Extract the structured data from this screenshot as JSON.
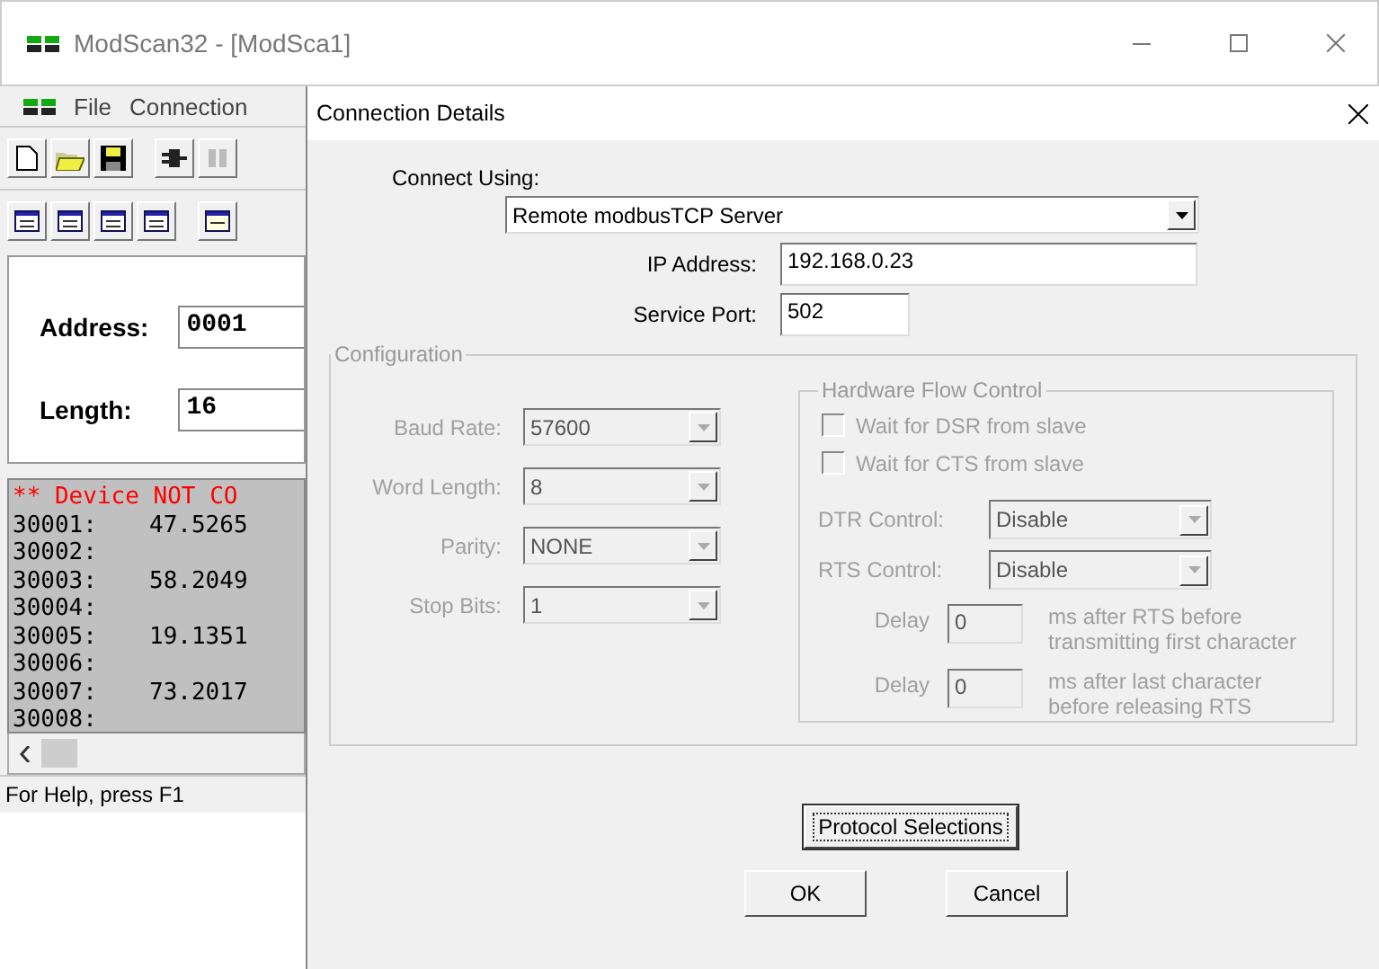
{
  "main_window": {
    "title": "ModScan32 - [ModSca1]",
    "menu": [
      "File",
      "Connection"
    ],
    "address_label": "Address:",
    "address_value": "0001",
    "length_label": "Length:",
    "length_value": "16",
    "status_message": "** Device NOT CO",
    "data_rows": [
      {
        "address": "30001:",
        "value": "47.5265"
      },
      {
        "address": "30002:",
        "value": ""
      },
      {
        "address": "30003:",
        "value": "58.2049"
      },
      {
        "address": "30004:",
        "value": ""
      },
      {
        "address": "30005:",
        "value": "19.1351"
      },
      {
        "address": "30006:",
        "value": ""
      },
      {
        "address": "30007:",
        "value": "73.2017"
      },
      {
        "address": "30008:",
        "value": ""
      }
    ],
    "status_bar": "For Help, press F1"
  },
  "dialog": {
    "title": "Connection Details",
    "connect_using_label": "Connect Using:",
    "connect_using_value": "Remote modbusTCP Server",
    "ip_label": "IP Address:",
    "ip_value": "192.168.0.23",
    "port_label": "Service Port:",
    "port_value": "502",
    "configuration": {
      "title": "Configuration",
      "disabled": true,
      "fields": [
        {
          "label": "Baud Rate:",
          "value": "57600"
        },
        {
          "label": "Word Length:",
          "value": "8"
        },
        {
          "label": "Parity:",
          "value": "NONE"
        },
        {
          "label": "Stop Bits:",
          "value": "1"
        }
      ],
      "hardware_flow_control": {
        "title": "Hardware Flow Control",
        "checkboxes": [
          {
            "label": "Wait for DSR from slave",
            "checked": false
          },
          {
            "label": "Wait for CTS from slave",
            "checked": false
          }
        ],
        "selects": [
          {
            "label": "DTR Control:",
            "value": "Disable"
          },
          {
            "label": "RTS Control:",
            "value": "Disable"
          }
        ],
        "delays": [
          {
            "label": "Delay",
            "value": "0",
            "note": "ms after RTS before transmitting first character"
          },
          {
            "label": "Delay",
            "value": "0",
            "note": "ms after last character before releasing RTS"
          }
        ]
      }
    },
    "protocol_button": "Protocol Selections",
    "ok_button": "OK",
    "cancel_button": "Cancel"
  }
}
